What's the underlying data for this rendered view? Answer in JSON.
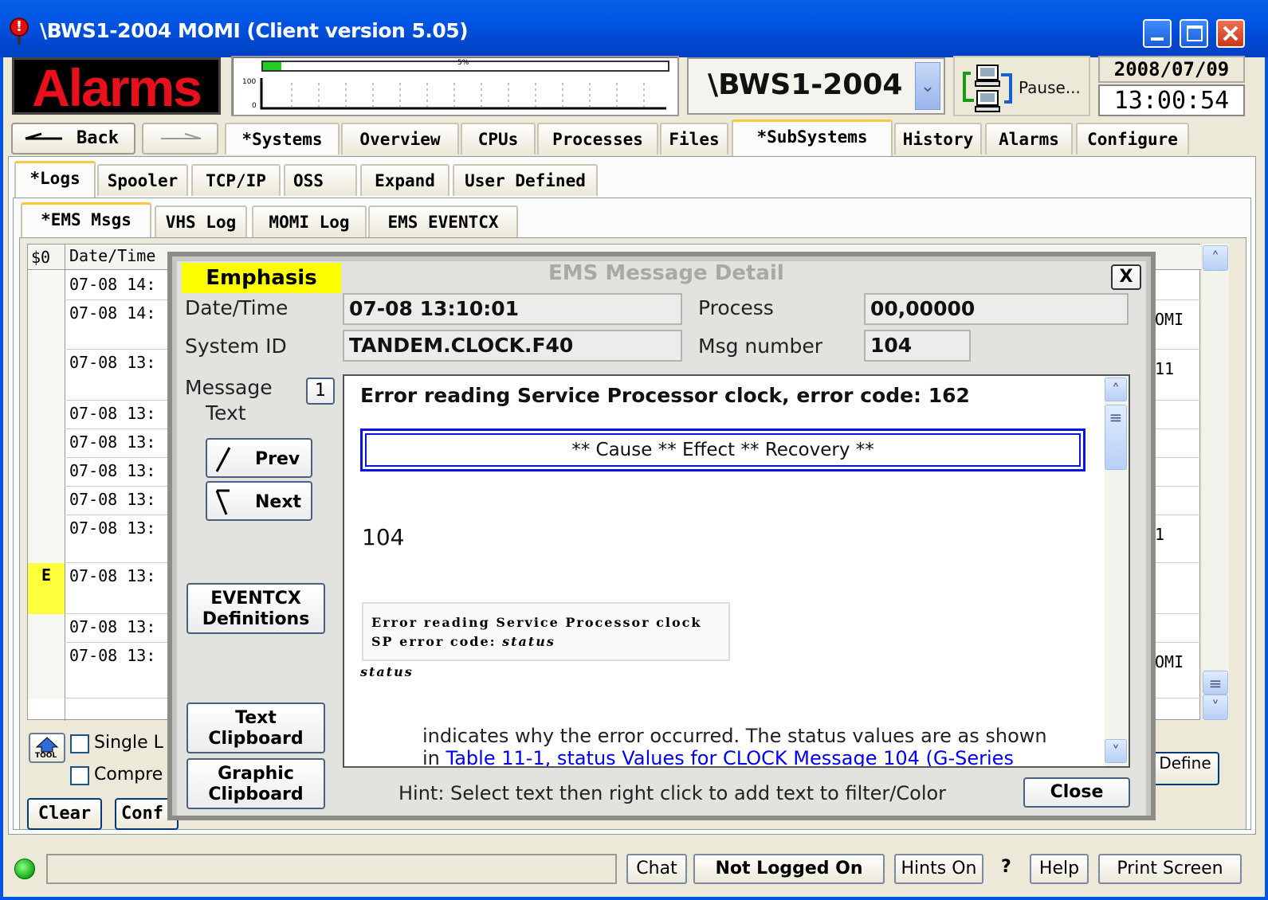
{
  "window": {
    "title": "\\BWS1-2004 MOMI (Client version 5.05)",
    "bang": "!"
  },
  "header": {
    "alarms_label": "Alarms",
    "gauge_top_label": "5%",
    "gauge_y_max": "100",
    "gauge_y_min": "0",
    "gauge_fill_fraction": 0.05,
    "node": "\\BWS1-2004",
    "pause_label": "Pause...",
    "date": "2008/07/09",
    "time": "13:00:54"
  },
  "nav": {
    "back_label": "Back",
    "main_tabs": [
      "*Systems",
      "Overview",
      "CPUs",
      "Processes",
      "Files",
      "*SubSystems",
      "History",
      "Alarms",
      "Configure"
    ],
    "sub_tabs": [
      "*Logs",
      "Spooler",
      "TCP/IP",
      "OSS",
      "Expand",
      "User Defined"
    ],
    "log_tabs": [
      "*EMS Msgs",
      "VHS Log",
      "MOMI Log",
      "EMS EVENTCX"
    ]
  },
  "grid": {
    "col0_header": "$0",
    "col1_header": "Date/Time",
    "rows": [
      {
        "flag": "",
        "time": "07-08 14:",
        "tail": ""
      },
      {
        "flag": "",
        "time": "07-08 14:",
        "tail": "OMI"
      },
      {
        "flag": "",
        "time": "07-08 13:",
        "tail": "11"
      },
      {
        "flag": "",
        "time": "07-08 13:",
        "tail": ""
      },
      {
        "flag": "",
        "time": "07-08 13:",
        "tail": ""
      },
      {
        "flag": "",
        "time": "07-08 13:",
        "tail": ""
      },
      {
        "flag": "",
        "time": "07-08 13:",
        "tail": ""
      },
      {
        "flag": "",
        "time": "07-08 13:",
        "tail": "1"
      },
      {
        "flag": "E",
        "time": "07-08 13:",
        "tail": ""
      },
      {
        "flag": "",
        "time": "07-08 13:",
        "tail": ""
      },
      {
        "flag": "",
        "time": "07-08 13:",
        "tail": "OMI"
      }
    ],
    "highlight_color": "#ffff3c"
  },
  "bottom_controls": {
    "single_label": "Single L",
    "compress_label": "Compre",
    "clear_label": "Clear",
    "conf_label": "Conf",
    "define_label": "Define",
    "tool_label": "TOOL"
  },
  "dialog": {
    "emphasis": "Emphasis",
    "title": "EMS Message Detail",
    "close_x": "X",
    "datetime_label": "Date/Time",
    "datetime_value": "07-08 13:10:01",
    "process_label": "Process",
    "process_value": "00,00000",
    "system_id_label": "System ID",
    "system_id_value": "TANDEM.CLOCK.F40",
    "msg_number_label": "Msg number",
    "msg_number_value": "104",
    "message_label": "Message",
    "text_label": "Text",
    "message_index": "1",
    "prev_label": "Prev",
    "next_label": "Next",
    "eventcx_line1": "EVENTCX",
    "eventcx_line2": "Definitions",
    "text_clip_line1": "Text",
    "text_clip_line2": "Clipboard",
    "graphic_clip_line1": "Graphic",
    "graphic_clip_line2": "Clipboard",
    "message_heading": "Error reading Service Processor clock, error code: 162",
    "cause_banner": "** Cause ** Effect ** Recovery **",
    "doc_number": "104",
    "code_line1": "Error reading Service Processor clock",
    "code_line2_prefix": "SP error code: ",
    "code_line2_var": "status",
    "var_name": "status",
    "desc_text": "indicates why the error occurred. The status values are as shown",
    "desc_link_prefix": "in ",
    "desc_link": "Table 11-1, status Values for CLOCK Message 104 (G-Series",
    "hint": "Hint: Select text then right click to add text to filter/Color",
    "close_label": "Close"
  },
  "statusbar": {
    "chat": "Chat",
    "logged": "Not Logged On",
    "hints": "Hints On",
    "question": "?",
    "help": "Help",
    "print": "Print Screen"
  },
  "colors": {
    "titlebar": "#0054e3",
    "alarm_red": "#e8101a",
    "emphasis_yellow": "#ffff00",
    "link_blue": "#0000ee",
    "banner_blue": "#0a14e0"
  }
}
